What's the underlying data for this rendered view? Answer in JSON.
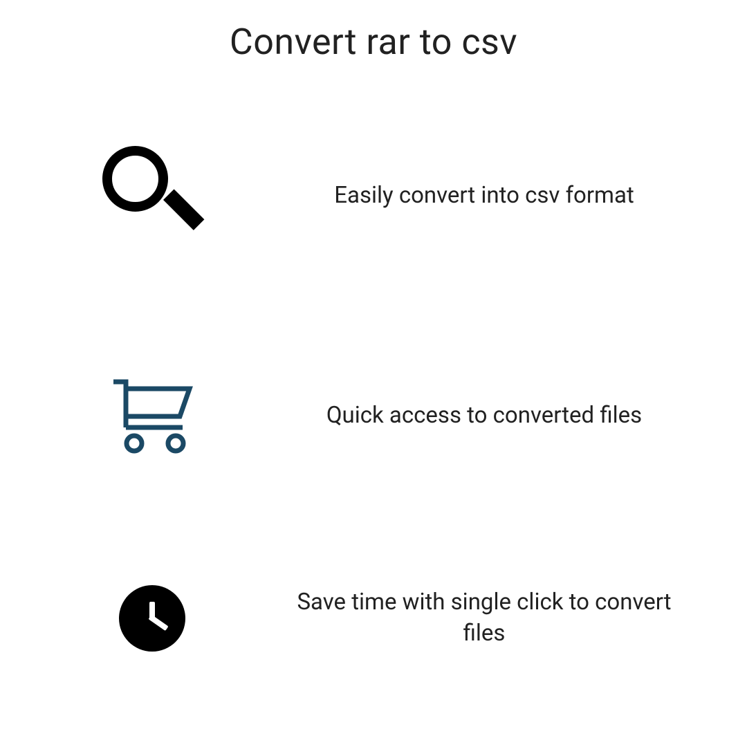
{
  "title": "Convert rar to csv",
  "features": [
    {
      "icon": "search-icon",
      "text": "Easily convert into csv format"
    },
    {
      "icon": "cart-icon",
      "text": "Quick access to converted files"
    },
    {
      "icon": "clock-icon",
      "text": "Save time with single click to convert files"
    }
  ],
  "colors": {
    "cart_stroke": "#1b4965",
    "text": "#212121",
    "icon_black": "#000000"
  }
}
